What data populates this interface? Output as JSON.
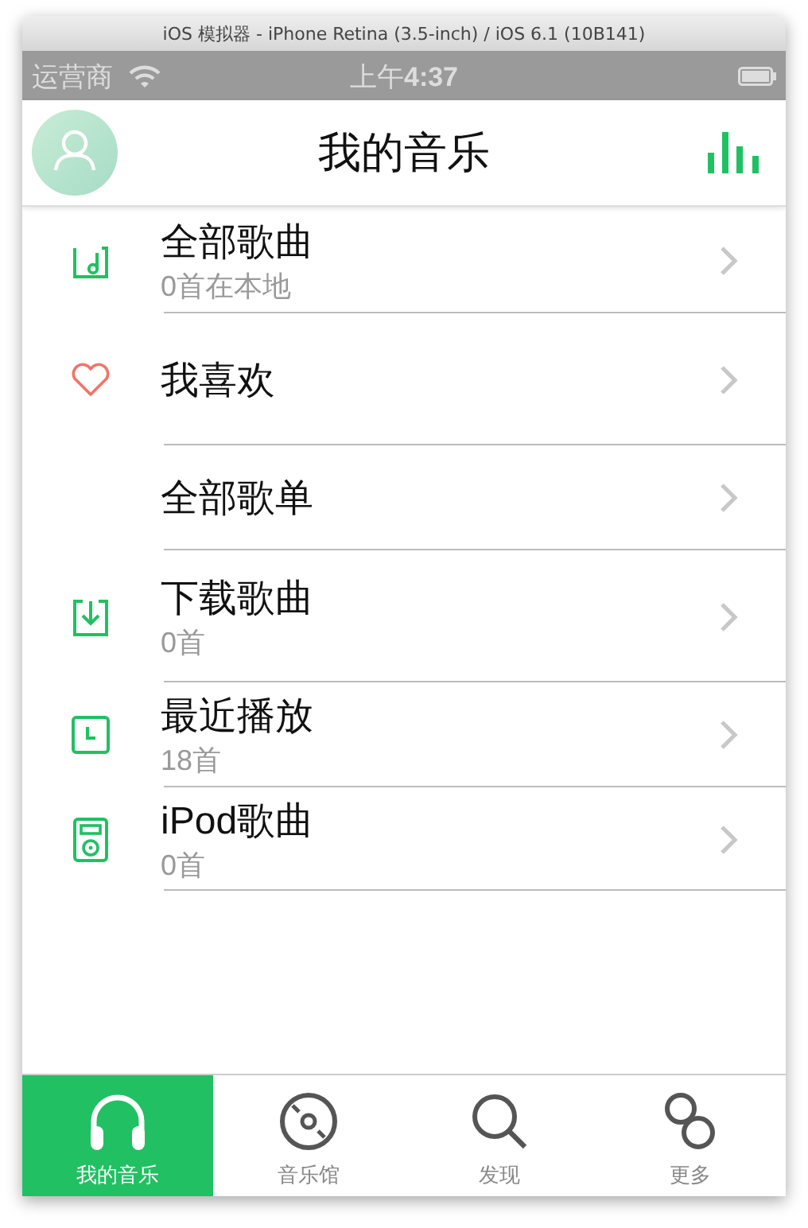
{
  "window": {
    "title": "iOS 模拟器 - iPhone Retina (3.5-inch) / iOS 6.1 (10B141)"
  },
  "status_bar": {
    "carrier": "运营商",
    "time_prefix": "上午",
    "time": "4:37"
  },
  "nav_bar": {
    "title": "我的音乐"
  },
  "items": [
    {
      "title": "全部歌曲",
      "subtitle": "0首在本地"
    },
    {
      "title": "我喜欢"
    },
    {
      "title": "全部歌单"
    },
    {
      "title": "下载歌曲",
      "subtitle": "0首"
    },
    {
      "title": "最近播放",
      "subtitle": "18首"
    },
    {
      "title": "iPod歌曲",
      "subtitle": "0首"
    }
  ],
  "tabs": [
    {
      "label": "我的音乐",
      "selected": true
    },
    {
      "label": "音乐馆",
      "selected": false
    },
    {
      "label": "发现",
      "selected": false
    },
    {
      "label": "更多",
      "selected": false
    }
  ]
}
